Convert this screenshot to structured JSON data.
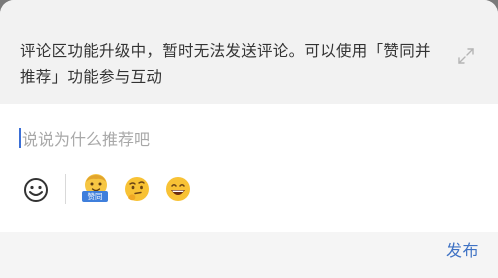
{
  "notice": {
    "text": "评论区功能升级中，暂时无法发送评论。可以使用「赞同并推荐」功能参与互动",
    "expand_icon": "expand-arrows-icon"
  },
  "editor": {
    "placeholder": "说说为什么推荐吧",
    "value": ""
  },
  "toolbar": {
    "items": [
      {
        "icon": "emoji-keyboard-icon"
      },
      {
        "icon": "agree-sticker-icon",
        "badge": "赞同"
      },
      {
        "icon": "thinking-face-icon"
      },
      {
        "icon": "grinning-face-icon"
      }
    ]
  },
  "footer": {
    "publish_label": "发布"
  },
  "colors": {
    "accent": "#3f72c4",
    "placeholder": "#a8a8a8",
    "notice_bg": "#f2f2f2"
  }
}
